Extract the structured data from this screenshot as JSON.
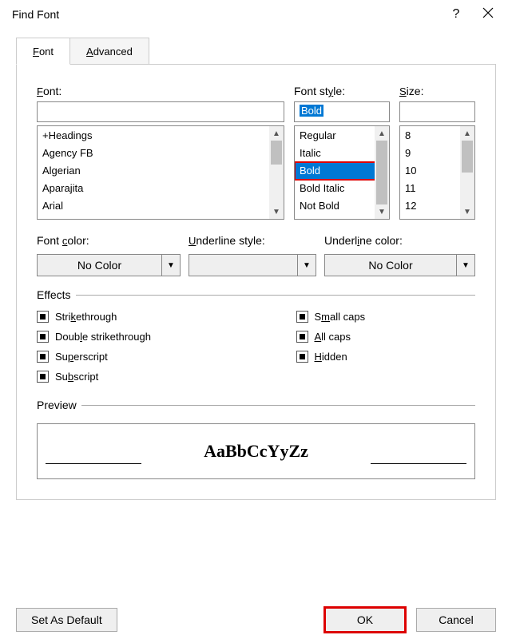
{
  "title": "Find Font",
  "tabs": {
    "font": "Font",
    "advanced": "Advanced"
  },
  "labels": {
    "font": "Font:",
    "fontStyle": "Font style:",
    "size": "Size:",
    "fontColor": "Font color:",
    "underlineStyle": "Underline style:",
    "underlineColor": "Underline color:",
    "effects": "Effects",
    "preview": "Preview"
  },
  "inputs": {
    "font": "",
    "fontStyle": "Bold",
    "size": ""
  },
  "fontList": [
    "+Headings",
    "Agency FB",
    "Algerian",
    "Aparajita",
    "Arial"
  ],
  "styleList": [
    "Regular",
    "Italic",
    "Bold",
    "Bold Italic",
    "Not Bold"
  ],
  "sizeList": [
    "8",
    "9",
    "10",
    "11",
    "12"
  ],
  "dropdowns": {
    "fontColor": "No Color",
    "underlineStyle": "",
    "underlineColor": "No Color"
  },
  "effectsList": {
    "left": [
      "Strikethrough",
      "Double strikethrough",
      "Superscript",
      "Subscript"
    ],
    "right": [
      "Small caps",
      "All caps",
      "Hidden"
    ]
  },
  "previewText": "AaBbCcYyZz",
  "buttons": {
    "setDefault": "Set As Default",
    "ok": "OK",
    "cancel": "Cancel"
  }
}
